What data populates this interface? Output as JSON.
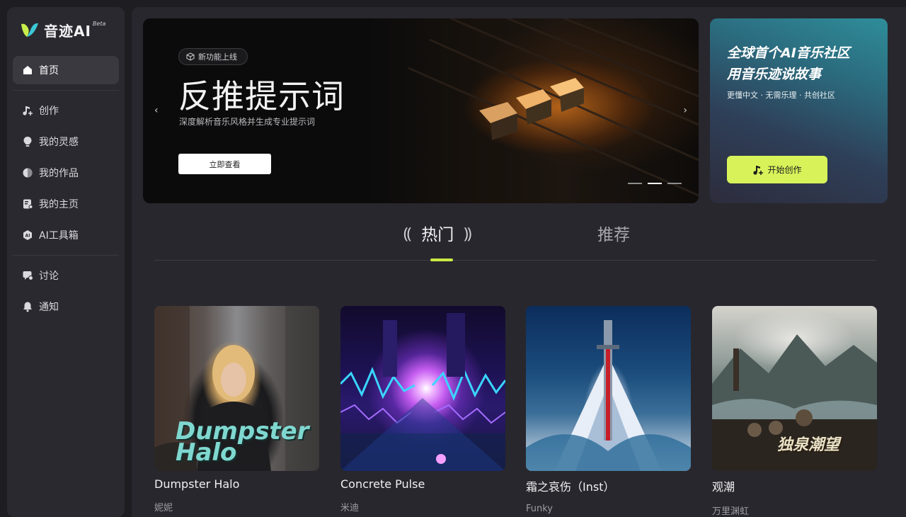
{
  "app": {
    "name": "音迹AI",
    "beta": "Beta"
  },
  "sidebar": {
    "items": [
      {
        "label": "首页",
        "icon": "home-icon",
        "active": true
      },
      {
        "label": "创作",
        "icon": "music-plus-icon"
      },
      {
        "label": "我的灵感",
        "icon": "lightbulb-icon"
      },
      {
        "label": "我的作品",
        "icon": "works-icon"
      },
      {
        "label": "我的主页",
        "icon": "profile-icon"
      },
      {
        "label": "AI工具箱",
        "icon": "ai-toolbox-icon"
      },
      {
        "label": "讨论",
        "icon": "discussion-icon"
      },
      {
        "label": "通知",
        "icon": "bell-icon"
      }
    ]
  },
  "banner": {
    "badge": "新功能上线",
    "title": "反推提示词",
    "subtitle": "深度解析音乐风格并生成专业提示词",
    "button": "立即查看",
    "prev": "‹",
    "next": "›",
    "slide_count": 3,
    "active_slide": 2
  },
  "promo": {
    "line1": "全球首个AI音乐社区",
    "line2": "用音乐迹说故事",
    "subtitle": "更懂中文 · 无需乐理 · 共创社区",
    "button": "开始创作",
    "accent": "#d8f35a"
  },
  "tabs": {
    "hot": "热门",
    "recommend": "推荐",
    "active": "hot",
    "indicator_color": "#c9ea45"
  },
  "songs": [
    {
      "title": "Dumpster Halo",
      "artist": "妮妮",
      "cover_text": "Dumpster Halo"
    },
    {
      "title": "Concrete Pulse",
      "artist": "米迪"
    },
    {
      "title": "霜之哀伤（Inst）",
      "artist": "Funky"
    },
    {
      "title": "观潮",
      "artist": "万里渊虹",
      "cover_text": "独泉潮望"
    }
  ]
}
